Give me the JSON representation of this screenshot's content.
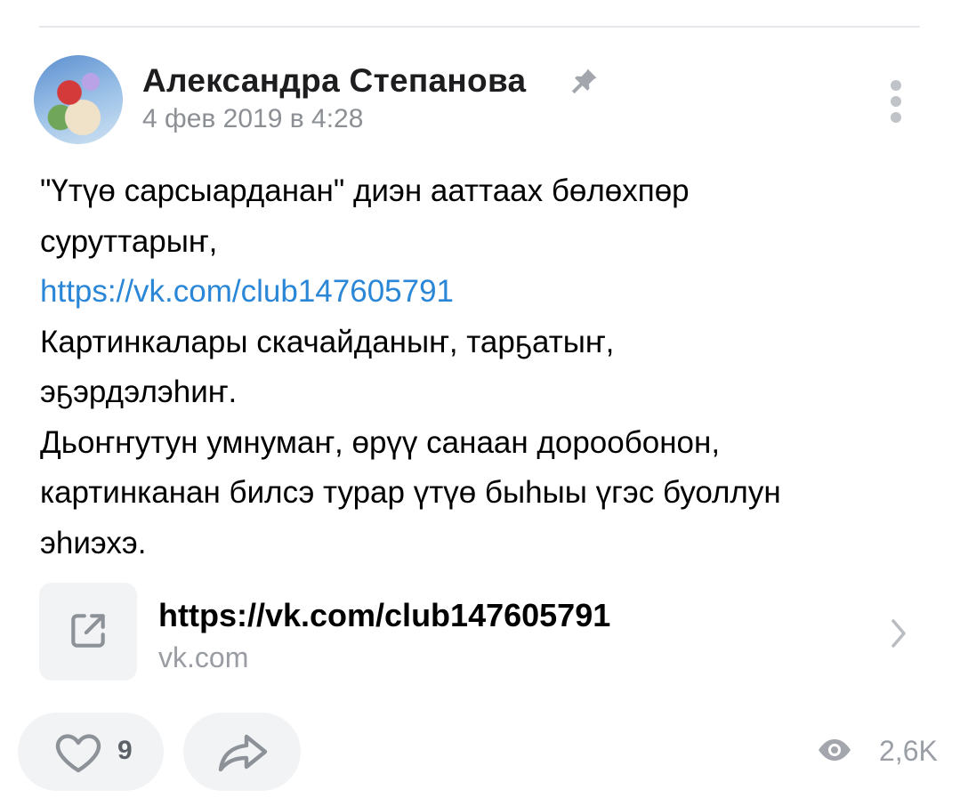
{
  "post": {
    "author": "Александра Степанова",
    "date": "4 фев 2019 в 4:28",
    "text_lines": [
      "\"Үтүө сарсыарданан\" диэн ааттаах бөлөхпөр",
      "суруттарыҥ,",
      "https://vk.com/club147605791",
      "Картинкалары скачайданыҥ, тарҕатыҥ,",
      "эҕэрдэлэһиҥ.",
      "Дьоҥҥутун умнумаҥ, өрүү санаан дорообонон,",
      "картинканан билсэ турар үтүө быһыы үгэс буоллун",
      "эһиэхэ."
    ]
  },
  "link_card": {
    "title": "https://vk.com/club147605791",
    "domain": "vk.com"
  },
  "actions": {
    "like_count": "9",
    "views": "2,6K"
  },
  "icons": {
    "pin": "pin-icon",
    "more": "more-vertical-icon",
    "external_link": "external-link-icon",
    "chevron": "chevron-right-icon",
    "like": "heart-icon",
    "share": "share-icon",
    "views": "eye-icon"
  },
  "colors": {
    "link": "#2a86d6",
    "muted": "#8c8f94",
    "button_bg": "#f2f3f5"
  }
}
